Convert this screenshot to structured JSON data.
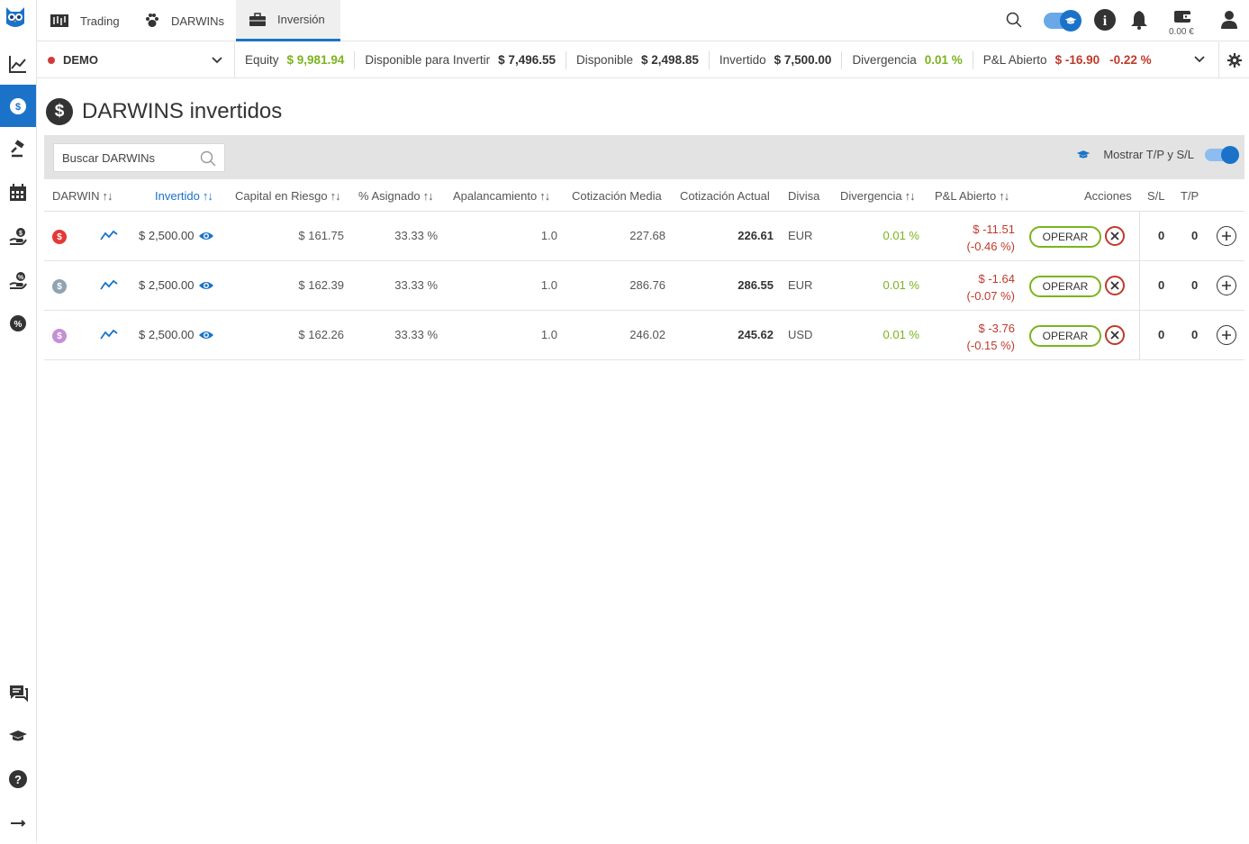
{
  "nav": {
    "tabs": [
      {
        "label": "Trading",
        "icon": "candlestick-icon"
      },
      {
        "label": "DARWINs",
        "icon": "paw-icon"
      },
      {
        "label": "Inversión",
        "icon": "briefcase-icon"
      }
    ],
    "wallet_value": "0.00 €"
  },
  "account": {
    "name": "DEMO",
    "metrics": [
      {
        "label": "Equity",
        "value": "$ 9,981.94",
        "color": "green"
      },
      {
        "label": "Disponible para Invertir",
        "value": "$ 7,496.55",
        "color": "default"
      },
      {
        "label": "Disponible",
        "value": "$ 2,498.85",
        "color": "default"
      },
      {
        "label": "Invertido",
        "value": "$ 7,500.00",
        "color": "default"
      },
      {
        "label": "Divergencia",
        "value": "0.01 %",
        "color": "green"
      },
      {
        "label": "P&L Abierto",
        "value": "$ -16.90",
        "value2": "-0.22 %",
        "color": "red"
      }
    ]
  },
  "page": {
    "title": "DARWINS invertidos",
    "search_placeholder": "Buscar DARWINs",
    "toggle_label": "Mostrar T/P y S/L"
  },
  "table": {
    "headers": {
      "darwin": "DARWIN",
      "invertido": "Invertido",
      "capital": "Capital en Riesgo",
      "asignado": "% Asignado",
      "apalancamiento": "Apalancamiento",
      "cot_media": "Cotización Media",
      "cot_actual": "Cotización Actual",
      "divisa": "Divisa",
      "divergencia": "Divergencia",
      "pnl": "P&L Abierto",
      "acciones": "Acciones",
      "sl": "S/L",
      "tp": "T/P"
    },
    "operar_label": "OPERAR",
    "rows": [
      {
        "coin_color": "#e53935",
        "invertido": "$ 2,500.00",
        "capital": "$ 161.75",
        "asignado": "33.33 %",
        "apalancamiento": "1.0",
        "cot_media": "227.68",
        "cot_actual": "226.61",
        "divisa": "EUR",
        "divergencia": "0.01 %",
        "pnl": "$ -11.51",
        "pnl_pct": "(-0.46 %)",
        "sl": "0",
        "tp": "0"
      },
      {
        "coin_color": "#8fa3b0",
        "invertido": "$ 2,500.00",
        "capital": "$ 162.39",
        "asignado": "33.33 %",
        "apalancamiento": "1.0",
        "cot_media": "286.76",
        "cot_actual": "286.55",
        "divisa": "EUR",
        "divergencia": "0.01 %",
        "pnl": "$ -1.64",
        "pnl_pct": "(-0.07 %)",
        "sl": "0",
        "tp": "0"
      },
      {
        "coin_color": "#c58fd6",
        "invertido": "$ 2,500.00",
        "capital": "$ 162.26",
        "asignado": "33.33 %",
        "apalancamiento": "1.0",
        "cot_media": "246.02",
        "cot_actual": "245.62",
        "divisa": "USD",
        "divergencia": "0.01 %",
        "pnl": "$ -3.76",
        "pnl_pct": "(-0.15 %)",
        "sl": "0",
        "tp": "0"
      }
    ]
  },
  "colors": {
    "accent": "#1a73c8",
    "positive": "#7ab41d",
    "negative": "#c0392b"
  }
}
